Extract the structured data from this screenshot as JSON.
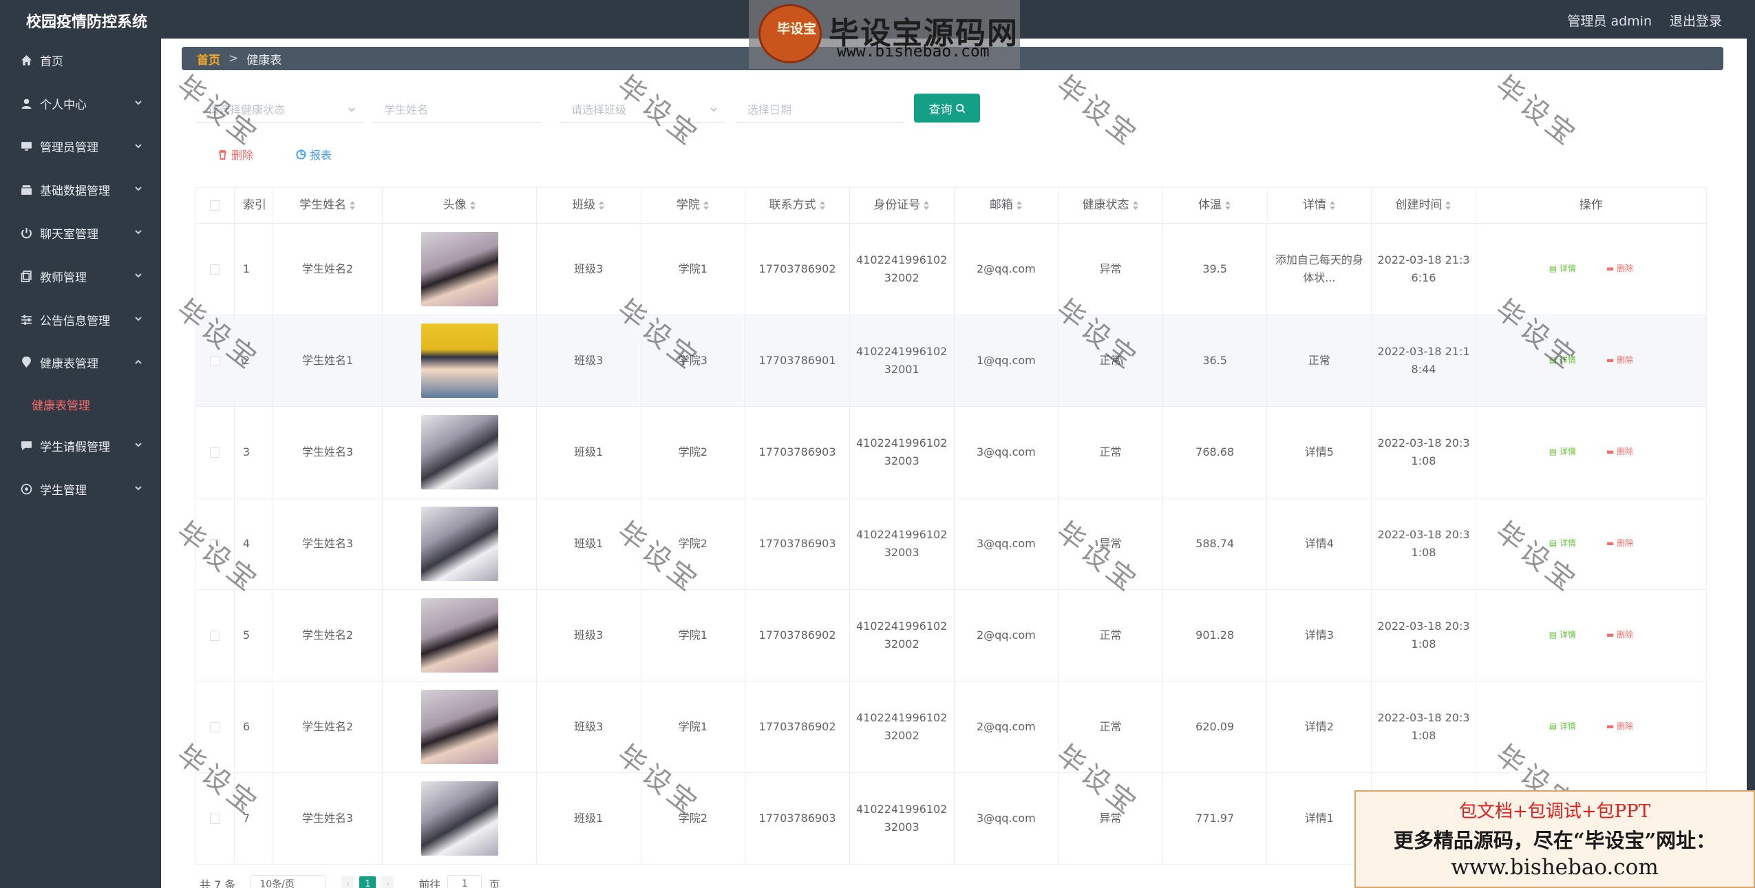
{
  "app": {
    "title": "校园疫情防控系统"
  },
  "header": {
    "user_label": "管理员 admin",
    "logout_label": "退出登录"
  },
  "sidebar": {
    "items": [
      {
        "label": "首页",
        "icon": "home-icon"
      },
      {
        "label": "个人中心",
        "icon": "user-icon"
      },
      {
        "label": "管理员管理",
        "icon": "monitor-icon"
      },
      {
        "label": "基础数据管理",
        "icon": "box-icon"
      },
      {
        "label": "聊天室管理",
        "icon": "power-icon"
      },
      {
        "label": "教师管理",
        "icon": "copy-icon"
      },
      {
        "label": "公告信息管理",
        "icon": "sliders-icon"
      },
      {
        "label": "健康表管理",
        "icon": "location-icon",
        "expanded": true
      },
      {
        "label": "学生请假管理",
        "icon": "chat-icon"
      },
      {
        "label": "学生管理",
        "icon": "compass-icon"
      }
    ],
    "sub_active": "健康表管理"
  },
  "breadcrumb": {
    "home": "首页",
    "separator": ">",
    "current": "健康表"
  },
  "logo": {
    "badge": "毕设宝",
    "title": "毕设宝源码网",
    "url": "www.bishebao.com"
  },
  "search": {
    "health_placeholder": "请选择健康状态",
    "name_placeholder": "学生姓名",
    "class_placeholder": "请选择班级",
    "date_placeholder": "选择日期",
    "query_label": "查询"
  },
  "actions": {
    "delete_label": "删除",
    "report_label": "报表"
  },
  "table": {
    "columns": [
      "索引",
      "学生姓名",
      "头像",
      "班级",
      "学院",
      "联系方式",
      "身份证号",
      "邮箱",
      "健康状态",
      "体温",
      "详情",
      "创建时间",
      "操作"
    ],
    "op_detail": "详情",
    "op_delete": "删除",
    "rows": [
      {
        "index": "1",
        "name": "学生姓名2",
        "avatar": "woman",
        "class": "班级3",
        "college": "学院1",
        "phone": "17703786902",
        "id1": "4102241996102",
        "id2": "32002",
        "email": "2@qq.com",
        "health": "异常",
        "temp": "39.5",
        "detail": "添加自己每天的身体状...",
        "t1": "2022-03-18 21:3",
        "t2": "6:16"
      },
      {
        "index": "2",
        "name": "学生姓名1",
        "avatar": "conan",
        "class": "班级3",
        "college": "学院3",
        "phone": "17703786901",
        "id1": "4102241996102",
        "id2": "32001",
        "email": "1@qq.com",
        "health": "正常",
        "temp": "36.5",
        "detail": "正常",
        "t1": "2022-03-18 21:1",
        "t2": "8:44"
      },
      {
        "index": "3",
        "name": "学生姓名3",
        "avatar": "husky",
        "class": "班级1",
        "college": "学院2",
        "phone": "17703786903",
        "id1": "4102241996102",
        "id2": "32003",
        "email": "3@qq.com",
        "health": "正常",
        "temp": "768.68",
        "detail": "详情5",
        "t1": "2022-03-18 20:3",
        "t2": "1:08"
      },
      {
        "index": "4",
        "name": "学生姓名3",
        "avatar": "husky",
        "class": "班级1",
        "college": "学院2",
        "phone": "17703786903",
        "id1": "4102241996102",
        "id2": "32003",
        "email": "3@qq.com",
        "health": "异常",
        "temp": "588.74",
        "detail": "详情4",
        "t1": "2022-03-18 20:3",
        "t2": "1:08"
      },
      {
        "index": "5",
        "name": "学生姓名2",
        "avatar": "woman",
        "class": "班级3",
        "college": "学院1",
        "phone": "17703786902",
        "id1": "4102241996102",
        "id2": "32002",
        "email": "2@qq.com",
        "health": "正常",
        "temp": "901.28",
        "detail": "详情3",
        "t1": "2022-03-18 20:3",
        "t2": "1:08"
      },
      {
        "index": "6",
        "name": "学生姓名2",
        "avatar": "woman",
        "class": "班级3",
        "college": "学院1",
        "phone": "17703786902",
        "id1": "4102241996102",
        "id2": "32002",
        "email": "2@qq.com",
        "health": "正常",
        "temp": "620.09",
        "detail": "详情2",
        "t1": "2022-03-18 20:3",
        "t2": "1:08"
      },
      {
        "index": "7",
        "name": "学生姓名3",
        "avatar": "husky",
        "class": "班级1",
        "college": "学院2",
        "phone": "17703786903",
        "id1": "4102241996102",
        "id2": "32003",
        "email": "3@qq.com",
        "health": "异常",
        "temp": "771.97",
        "detail": "详情1",
        "t1": "",
        "t2": ""
      }
    ]
  },
  "pagination": {
    "total": "共 7 条",
    "page_size": "10条/页",
    "current_page": "1",
    "goto_prefix": "前往",
    "goto_value": "1",
    "goto_suffix": "页"
  },
  "ad": {
    "line1": "包文档+包调试+包PPT",
    "line2": "更多精品源码，尽在“毕设宝”网址：",
    "line3": "www.bishebao.com"
  },
  "watermark": "毕设宝",
  "colors": {
    "sidebar": "#2f3a45",
    "accent": "#13a087",
    "danger": "#f56c6c",
    "link": "#409eff",
    "success": "#67c23a"
  }
}
